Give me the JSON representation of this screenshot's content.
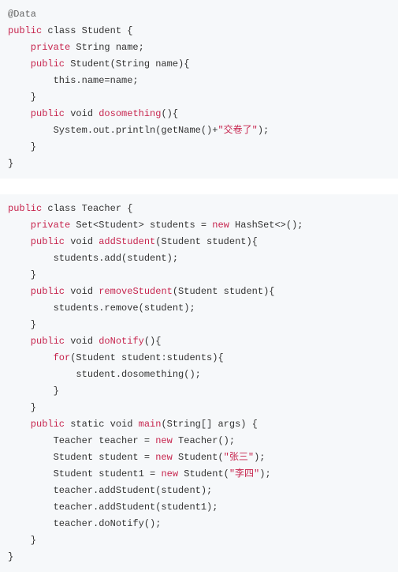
{
  "block1": {
    "l1": "@Data",
    "l2a": "public",
    "l2b": " class Student {",
    "l3a": "    private",
    "l3b": " String name;",
    "l4a": "    public",
    "l4b": " Student(String name){",
    "l5": "        this.name=name;",
    "l6": "    }",
    "l7a": "    public",
    "l7b": " void ",
    "l7c": "dosomething",
    "l7d": "(){",
    "l8a": "        System.out.println(getName()+",
    "l8b": "\"交卷了\"",
    "l8c": ");",
    "l9": "    }",
    "l10": "}"
  },
  "block2": {
    "l1a": "public",
    "l1b": " class Teacher {",
    "l2a": "    private",
    "l2b": " Set<Student> students = ",
    "l2c": "new",
    "l2d": " HashSet<>();",
    "l3a": "    public",
    "l3b": " void ",
    "l3c": "addStudent",
    "l3d": "(Student student){",
    "l4": "        students.add(student);",
    "l5": "    }",
    "l6a": "    public",
    "l6b": " void ",
    "l6c": "removeStudent",
    "l6d": "(Student student){",
    "l7": "        students.remove(student);",
    "l8": "    }",
    "l9a": "    public",
    "l9b": " void ",
    "l9c": "doNotify",
    "l9d": "(){",
    "l10a": "        for",
    "l10b": "(Student student:students){",
    "l11": "            student.dosomething();",
    "l12": "        }",
    "l13": "    }",
    "l14a": "    public",
    "l14b": " static void ",
    "l14c": "main",
    "l14d": "(String[] args) {",
    "l15a": "        Teacher teacher = ",
    "l15b": "new",
    "l15c": " Teacher();",
    "l16a": "        Student student = ",
    "l16b": "new",
    "l16c": " Student(",
    "l16d": "\"张三\"",
    "l16e": ");",
    "l17a": "        Student student1 = ",
    "l17b": "new",
    "l17c": " Student(",
    "l17d": "\"李四\"",
    "l17e": ");",
    "l18": "        teacher.addStudent(student);",
    "l19": "        teacher.addStudent(student1);",
    "l20": "        teacher.doNotify();",
    "l21": "    }",
    "l22": "}"
  }
}
